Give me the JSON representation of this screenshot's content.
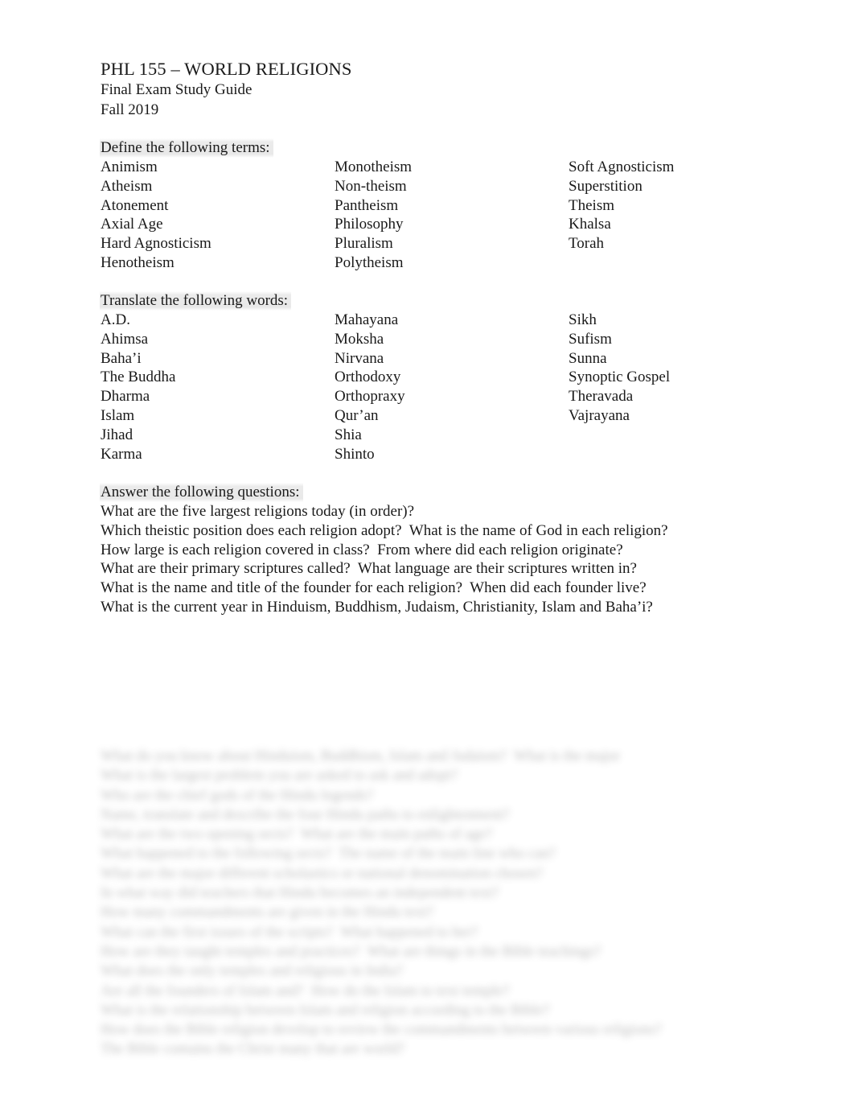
{
  "document": {
    "title": "PHL 155 – WORLD RELIGIONS",
    "subtitle_line1": "Final Exam Study Guide",
    "subtitle_line2": "Fall 2019"
  },
  "define_section": {
    "heading": "Define the following terms:",
    "columns": [
      [
        "Animism",
        "Atheism",
        "Atonement",
        "Axial Age",
        "Hard Agnosticism",
        "Henotheism"
      ],
      [
        "Monotheism",
        "Non-theism",
        "Pantheism",
        "Philosophy",
        "Pluralism",
        "Polytheism"
      ],
      [
        "Soft Agnosticism",
        "Superstition",
        "Theism",
        "Khalsa",
        "Torah"
      ]
    ]
  },
  "translate_section": {
    "heading": "Translate the following words:",
    "columns": [
      [
        "A.D.",
        "Ahimsa",
        "Baha’i",
        "The Buddha",
        "Dharma",
        "Islam",
        "Jihad",
        "Karma"
      ],
      [
        "Mahayana",
        "Moksha",
        "Nirvana",
        "Orthodoxy",
        "Orthopraxy",
        "Qur’an",
        "Shia",
        "Shinto"
      ],
      [
        "Sikh",
        "Sufism",
        "Sunna",
        "Synoptic Gospel",
        "Theravada",
        "Vajrayana"
      ]
    ]
  },
  "questions_section": {
    "heading": "Answer the following questions:",
    "lines": [
      "What are the five largest religions today (in order)?",
      "Which theistic position does each religion adopt?  What is the name of God in each religion?",
      "How large is each religion covered in class?  From where did each religion originate?",
      "What are their primary scriptures called?  What language are their scriptures written in?",
      "What is the name and title of the founder for each religion?  When did each founder live?",
      "What is the current year in Hinduism, Buddhism, Judaism, Christianity, Islam and Baha’i?"
    ]
  },
  "obscured_section": {
    "note": "illegible blurred text",
    "lines": [
      "What do you know about Hinduism, Buddhism, Islam and Judaism?  What is the major",
      "What is the largest problem you are asked to ask and adopt?",
      "Who are the chief gods of the Hindu legends?",
      "Name, translate and describe the four Hindu paths to enlightenment?",
      "What are the two opening sects?  What are the main paths of age?",
      "What happened to the following sects?  The name of the main line who can?",
      "What are the major different scholastics or national denomination chosen?",
      "In what way did teachers that Hindu becomes an independent text?",
      "How many commandments are given in the Hindu text?",
      "What can the first issues of the scripts?  What happened to her?",
      "How are they taught temples and practices?  What are things in the Bible teachings?",
      "What does the only temples and religious in India?",
      "Are all the founders of Islam and?  How do the Islam to text temple?",
      "What is the relationship between Islam and religion according to the Bible?",
      "How does the Bible religion develop to review the commandments between various religions?",
      "The Bible contains the Christ many that are world?"
    ]
  }
}
